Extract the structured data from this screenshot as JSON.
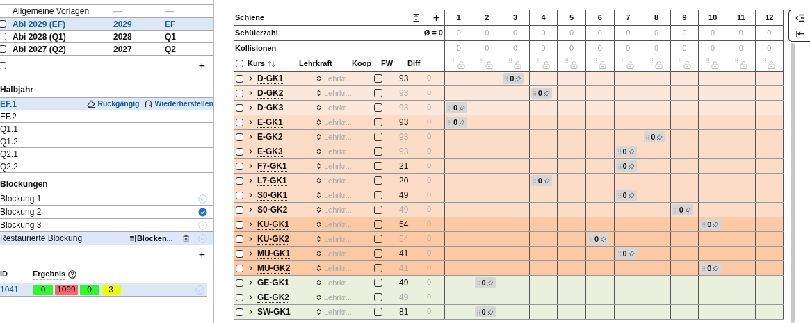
{
  "vorlagen": {
    "header": {
      "name": "Allgemeine Vorlagen",
      "year": "—",
      "stage": "—"
    },
    "items": [
      {
        "name": "Abi 2029 (EF)",
        "year": "2029",
        "stage": "EF",
        "selected": true,
        "checked": false
      },
      {
        "name": "Abi 2028 (Q1)",
        "year": "2028",
        "stage": "Q1",
        "selected": false,
        "checked": false
      },
      {
        "name": "Abi 2027 (Q2)",
        "year": "2027",
        "stage": "Q2",
        "selected": false,
        "checked": false
      }
    ],
    "add_label": "+",
    "add_row_checked": false
  },
  "halbjahr": {
    "title": "Halbjahr",
    "undo_label": "Rückgängig",
    "redo_label": "Wiederherstellen",
    "items": [
      {
        "label": "EF.1",
        "selected": true
      },
      {
        "label": "EF.2",
        "selected": false
      },
      {
        "label": "Q1.1",
        "selected": false
      },
      {
        "label": "Q1.2",
        "selected": false
      },
      {
        "label": "Q2.1",
        "selected": false
      },
      {
        "label": "Q2.2",
        "selected": false
      }
    ]
  },
  "blockungen": {
    "title": "Blockungen",
    "blocken_label": "Blocken...",
    "add_label": "+",
    "items": [
      {
        "label": "Blockung 1",
        "selected": false,
        "active": false
      },
      {
        "label": "Blockung 2",
        "selected": false,
        "active": true
      },
      {
        "label": "Blockung 3",
        "selected": false,
        "active": false
      },
      {
        "label": "Restaurierte Blockung",
        "selected": true,
        "active": false
      }
    ]
  },
  "ergebnisse": {
    "id_header": "ID",
    "result_header": "Ergebnis",
    "rows": [
      {
        "id": "1041",
        "selected": true,
        "badges": [
          {
            "value": "0",
            "color": "#33f533"
          },
          {
            "value": "1099",
            "color": "#f86a6a"
          },
          {
            "value": "0",
            "color": "#33f533"
          },
          {
            "value": "3",
            "color": "#eeff00"
          }
        ]
      }
    ]
  },
  "kurstabelle": {
    "schiene_label": "Schiene",
    "add_label": "+",
    "schuelerzahl_label": "Schülerzahl",
    "average": "Ø = 0",
    "kollisionen_label": "Kollisionen",
    "all_checked": false,
    "columns": {
      "kurs": "Kurs",
      "lehrkraft": "Lehrkraft",
      "koop": "Koop",
      "fw": "FW",
      "diff": "Diff"
    },
    "schienen": [
      {
        "label": "1",
        "schueler": "0",
        "kollisionen": "0"
      },
      {
        "label": "2",
        "schueler": "0",
        "kollisionen": "0"
      },
      {
        "label": "3",
        "schueler": "0",
        "kollisionen": "0"
      },
      {
        "label": "4",
        "schueler": "0",
        "kollisionen": "0"
      },
      {
        "label": "5",
        "schueler": "0",
        "kollisionen": "0"
      },
      {
        "label": "6",
        "schueler": "0",
        "kollisionen": "0"
      },
      {
        "label": "7",
        "schueler": "0",
        "kollisionen": "0"
      },
      {
        "label": "8",
        "schueler": "0",
        "kollisionen": "0"
      },
      {
        "label": "9",
        "schueler": "0",
        "kollisionen": "0"
      },
      {
        "label": "10",
        "schueler": "0",
        "kollisionen": "0"
      },
      {
        "label": "11",
        "schueler": "0",
        "kollisionen": "0"
      },
      {
        "label": "12",
        "schueler": "0",
        "kollisionen": "0"
      }
    ],
    "rows": [
      {
        "kurs": "D-GK1",
        "lehrkraft_placeholder": "Lehrkr...",
        "fw": "93",
        "fw_muted": false,
        "diff": "0",
        "color": "#fce8da",
        "cells": [
          null,
          null,
          {
            "chip": "0"
          },
          null,
          null,
          null,
          null,
          null,
          null,
          null,
          null,
          null
        ]
      },
      {
        "kurs": "D-GK2",
        "lehrkraft_placeholder": "Lehrkr...",
        "fw": "93",
        "fw_muted": true,
        "diff": "0",
        "color": "#fce8da",
        "cells": [
          null,
          null,
          null,
          {
            "chip": "0"
          },
          null,
          null,
          null,
          null,
          null,
          null,
          null,
          null
        ]
      },
      {
        "kurs": "D-GK3",
        "lehrkraft_placeholder": "Lehrkr...",
        "fw": "93",
        "fw_muted": true,
        "diff": "0",
        "color": "#fce8da",
        "cells": [
          {
            "chip": "0"
          },
          null,
          null,
          null,
          null,
          null,
          null,
          null,
          null,
          null,
          null,
          null
        ]
      },
      {
        "kurs": "E-GK1",
        "lehrkraft_placeholder": "Lehrkr...",
        "fw": "93",
        "fw_muted": false,
        "diff": "0",
        "color": "#fcdcc6",
        "cells": [
          {
            "chip": "0"
          },
          null,
          null,
          null,
          null,
          null,
          null,
          null,
          null,
          null,
          null,
          null
        ]
      },
      {
        "kurs": "E-GK2",
        "lehrkraft_placeholder": "Lehrkr...",
        "fw": "93",
        "fw_muted": true,
        "diff": "0",
        "color": "#fcdcc6",
        "cells": [
          null,
          null,
          null,
          null,
          null,
          null,
          null,
          {
            "chip": "0"
          },
          null,
          null,
          null,
          null
        ]
      },
      {
        "kurs": "E-GK3",
        "lehrkraft_placeholder": "Lehrkr...",
        "fw": "93",
        "fw_muted": true,
        "diff": "0",
        "color": "#fcdcc6",
        "cells": [
          null,
          null,
          null,
          null,
          null,
          null,
          {
            "chip": "0"
          },
          null,
          null,
          null,
          null,
          null
        ]
      },
      {
        "kurs": "F7-GK1",
        "lehrkraft_placeholder": "Lehrkr...",
        "fw": "21",
        "fw_muted": false,
        "diff": "0",
        "color": "#fcdcc6",
        "cells": [
          null,
          null,
          null,
          null,
          null,
          null,
          {
            "chip": "0"
          },
          null,
          null,
          null,
          null,
          null
        ]
      },
      {
        "kurs": "L7-GK1",
        "lehrkraft_placeholder": "Lehrkr...",
        "fw": "20",
        "fw_muted": false,
        "diff": "0",
        "color": "#fcdcc6",
        "cells": [
          null,
          null,
          null,
          {
            "chip": "0"
          },
          null,
          null,
          null,
          null,
          null,
          null,
          null,
          null
        ]
      },
      {
        "kurs": "S0-GK1",
        "lehrkraft_placeholder": "Lehrkr...",
        "fw": "49",
        "fw_muted": false,
        "diff": "0",
        "color": "#fcdcc6",
        "cells": [
          null,
          null,
          null,
          null,
          null,
          null,
          {
            "chip": "0"
          },
          null,
          null,
          null,
          null,
          null
        ]
      },
      {
        "kurs": "S0-GK2",
        "lehrkraft_placeholder": "Lehrkr...",
        "fw": "49",
        "fw_muted": true,
        "diff": "0",
        "color": "#fcdcc6",
        "cells": [
          null,
          null,
          null,
          null,
          null,
          null,
          null,
          null,
          {
            "chip": "0"
          },
          null,
          null,
          null
        ]
      },
      {
        "kurs": "KU-GK1",
        "lehrkraft_placeholder": "Lehrkr...",
        "fw": "54",
        "fw_muted": false,
        "diff": "0",
        "color": "#fbcaa5",
        "cells": [
          null,
          null,
          null,
          null,
          null,
          null,
          null,
          null,
          null,
          {
            "chip": "0"
          },
          null,
          null
        ]
      },
      {
        "kurs": "KU-GK2",
        "lehrkraft_placeholder": "Lehrkr...",
        "fw": "54",
        "fw_muted": true,
        "diff": "0",
        "color": "#fbcaa5",
        "cells": [
          null,
          null,
          null,
          null,
          null,
          {
            "chip": "0"
          },
          null,
          null,
          null,
          null,
          null,
          null
        ]
      },
      {
        "kurs": "MU-GK1",
        "lehrkraft_placeholder": "Lehrkr...",
        "fw": "41",
        "fw_muted": false,
        "diff": "0",
        "color": "#fbcaa5",
        "cells": [
          null,
          null,
          null,
          null,
          null,
          null,
          {
            "chip": "0"
          },
          null,
          null,
          null,
          null,
          null
        ]
      },
      {
        "kurs": "MU-GK2",
        "lehrkraft_placeholder": "Lehrkr...",
        "fw": "41",
        "fw_muted": true,
        "diff": "0",
        "color": "#fbcaa5",
        "cells": [
          null,
          null,
          null,
          null,
          null,
          null,
          null,
          null,
          null,
          {
            "chip": "0"
          },
          null,
          null
        ]
      },
      {
        "kurs": "GE-GK1",
        "lehrkraft_placeholder": "Lehrkr...",
        "fw": "49",
        "fw_muted": false,
        "diff": "0",
        "color": "#e9f0de",
        "cells": [
          null,
          {
            "chip": "0"
          },
          null,
          null,
          null,
          null,
          null,
          null,
          null,
          null,
          null,
          null
        ]
      },
      {
        "kurs": "GE-GK2",
        "lehrkraft_placeholder": "Lehrkr...",
        "fw": "49",
        "fw_muted": true,
        "diff": "0",
        "color": "#e9f0de",
        "cells": [
          null,
          null,
          null,
          null,
          null,
          null,
          null,
          null,
          null,
          null,
          null,
          null
        ]
      },
      {
        "kurs": "SW-GK1",
        "lehrkraft_placeholder": "Lehrkr...",
        "fw": "81",
        "fw_muted": false,
        "diff": "0",
        "color": "#e9f0de",
        "cells": [
          null,
          {
            "chip": "0"
          },
          null,
          null,
          null,
          null,
          null,
          null,
          null,
          null,
          null,
          null
        ]
      }
    ]
  }
}
